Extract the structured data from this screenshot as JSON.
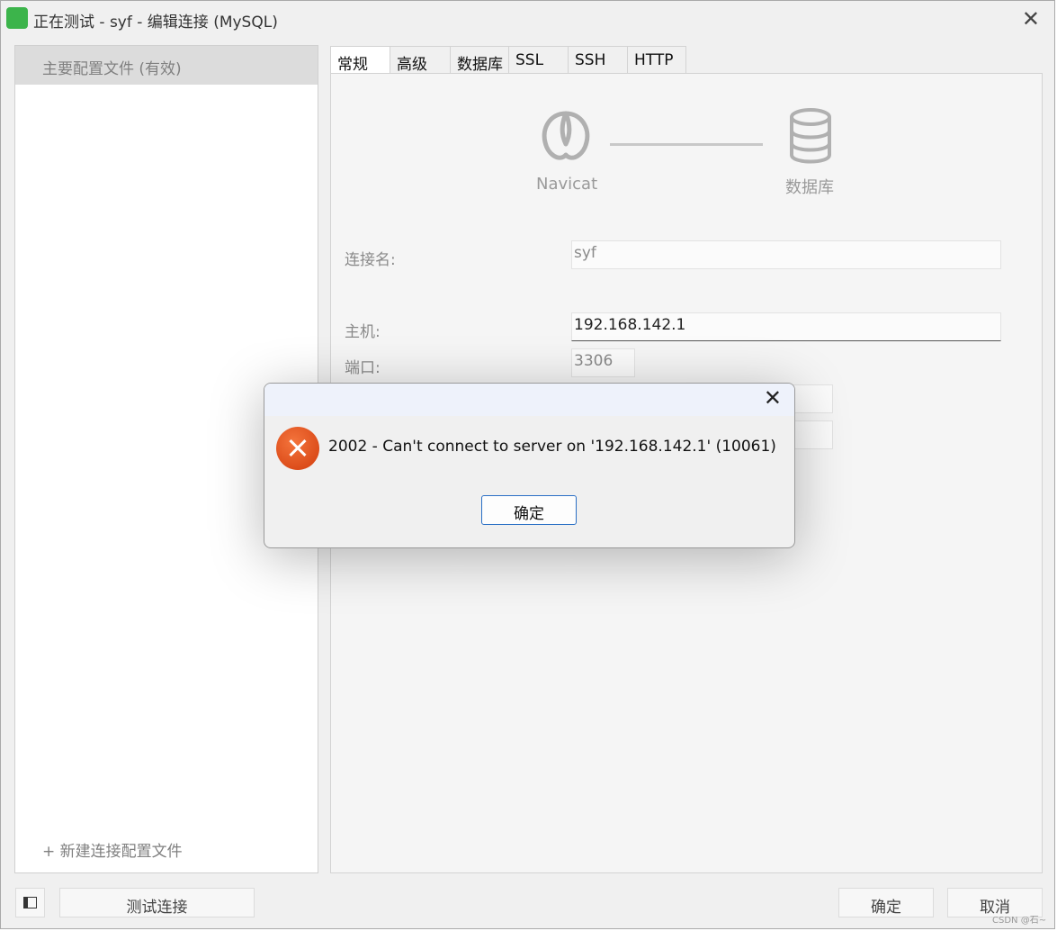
{
  "window": {
    "title": "正在测试 - syf - 编辑连接 (MySQL)"
  },
  "left_panel": {
    "selected_profile": "主要配置文件 (有效)",
    "new_profile": "+ 新建连接配置文件"
  },
  "tabs": [
    "常规",
    "高级",
    "数据库",
    "SSL",
    "SSH",
    "HTTP"
  ],
  "diagram": {
    "left_label": "Navicat",
    "right_label": "数据库"
  },
  "form": {
    "conn_name_label": "连接名:",
    "conn_name_value": "syf",
    "host_label": "主机:",
    "host_value": "192.168.142.1",
    "port_label": "端口:",
    "port_value": "3306"
  },
  "bottom": {
    "test_button": "测试连接",
    "ok_button": "确定",
    "cancel_button": "取消"
  },
  "dialog": {
    "message": "2002 - Can't connect to server on '192.168.142.1' (10061)",
    "ok_button": "确定"
  },
  "watermark": "CSDN @石~",
  "colors": {
    "app_icon": "#3cb44b",
    "error_icon": "#e8501a",
    "dialog_button_border": "#2a6fc5"
  }
}
